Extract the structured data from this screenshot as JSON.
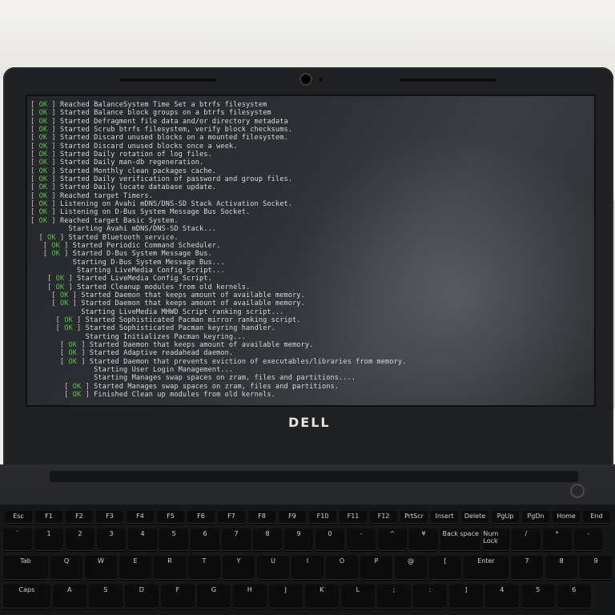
{
  "device": {
    "brand": "DELL"
  },
  "console_lines": [
    {
      "status": "OK",
      "text": "Reached BalanceSystem Time Set a btrfs filesystem"
    },
    {
      "status": "OK",
      "text": "Started Balance block groups on a btrfs filesystem"
    },
    {
      "status": "OK",
      "text": "Started Defragment file data and/or directory metadata"
    },
    {
      "status": "OK",
      "text": "Started Scrub btrfs filesystem, verify block checksums."
    },
    {
      "status": "OK",
      "text": "Started Discard unused blocks on a mounted filesystem."
    },
    {
      "status": "OK",
      "text": "Started Discard unused blocks once a week."
    },
    {
      "status": "OK",
      "text": "Started Daily rotation of log files."
    },
    {
      "status": "OK",
      "text": "Started Daily man-db regeneration."
    },
    {
      "status": "OK",
      "text": "Started Monthly clean packages cache."
    },
    {
      "status": "OK",
      "text": "Started Daily verification of password and group files."
    },
    {
      "status": "OK",
      "text": "Started Daily locate database update."
    },
    {
      "status": "OK",
      "text": "Reached target Timers."
    },
    {
      "status": "OK",
      "text": "Listening on Avahi mDNS/DNS-SD Stack Activation Socket."
    },
    {
      "status": "OK",
      "text": "Listening on D-Bus System Message Bus Socket."
    },
    {
      "status": "OK",
      "text": "Reached target Basic System."
    },
    {
      "status": "",
      "text": "Starting Avahi mDNS/DNS-SD Stack..."
    },
    {
      "status": "OK",
      "text": "Started Bluetooth service."
    },
    {
      "status": "OK",
      "text": "Started Periodic Command Scheduler."
    },
    {
      "status": "OK",
      "text": "Started D-Bus System Message Bus."
    },
    {
      "status": "",
      "text": "Starting D-Bus System Message Bus..."
    },
    {
      "status": "",
      "text": "Starting LiveMedia Config Script..."
    },
    {
      "status": "OK",
      "text": "Started LiveMedia Config Script."
    },
    {
      "status": "OK",
      "text": "Started Cleanup modules from old kernels."
    },
    {
      "status": "OK",
      "text": "Started Daemon that keeps amount of available memory."
    },
    {
      "status": "OK",
      "text": "Started Daemon that keeps amount of available memory."
    },
    {
      "status": "",
      "text": "Starting LiveMedia MHWD Script ranking script..."
    },
    {
      "status": "OK",
      "text": "Started Sophisticated Pacman mirror ranking script."
    },
    {
      "status": "OK",
      "text": "Started Sophisticated Pacman keyring handler."
    },
    {
      "status": "",
      "text": "Starting Initializes Pacman keyring..."
    },
    {
      "status": "OK",
      "text": "Started Daemon that keeps amount of available memory."
    },
    {
      "status": "OK",
      "text": "Started Adaptive readahead daemon."
    },
    {
      "status": "OK",
      "text": "Started Daemon that prevents eviction of executables/libraries from memory."
    },
    {
      "status": "",
      "text": "Starting User Login Management..."
    },
    {
      "status": "",
      "text": "Starting Manages swap spaces on zram, files and partitions...."
    },
    {
      "status": "OK",
      "text": "Started Manages swap spaces on zram, files and partitions."
    },
    {
      "status": "OK",
      "text": "Finished Clean up modules from old kernels."
    }
  ],
  "keyboard": {
    "function_row": [
      "Esc",
      "F1",
      "F2",
      "F3",
      "F4",
      "F5",
      "F6",
      "F7",
      "F8",
      "F9",
      "F10",
      "F11",
      "F12",
      "PrtScr",
      "Insert",
      "Delete",
      "PgUp",
      "PgDn",
      "Home",
      "End"
    ],
    "number_row": [
      "`",
      "1",
      "2",
      "3",
      "4",
      "5",
      "6",
      "7",
      "8",
      "9",
      "0",
      "-",
      "^",
      "¥",
      "Back space",
      "Num Lock",
      "/",
      "*",
      "-"
    ],
    "top_row": [
      "Tab",
      "Q",
      "W",
      "E",
      "R",
      "T",
      "Y",
      "U",
      "I",
      "O",
      "P",
      "@",
      "[",
      "Enter",
      "7",
      "8",
      "9"
    ],
    "home_row": [
      "Caps",
      "A",
      "S",
      "D",
      "F",
      "G",
      "H",
      "J",
      "K",
      "L",
      ";",
      ":",
      "]",
      "4",
      "5",
      "6"
    ]
  }
}
